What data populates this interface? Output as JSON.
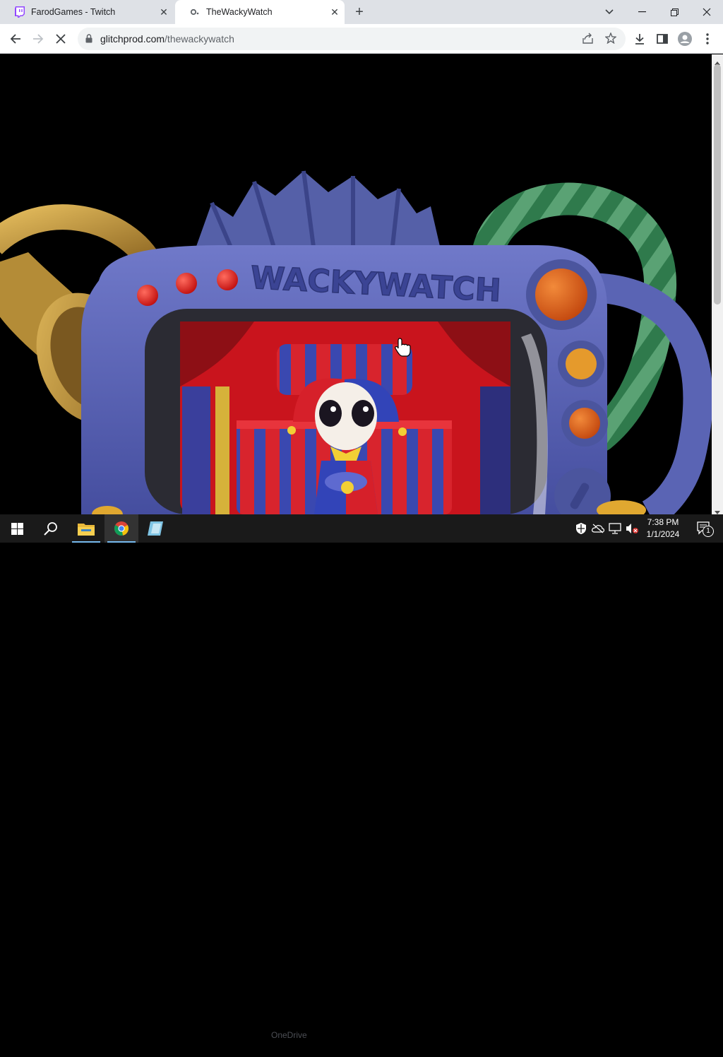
{
  "browser": {
    "tabs": [
      {
        "title": "FarodGames - Twitch",
        "active": false,
        "icon": "twitch-icon"
      },
      {
        "title": "TheWackyWatch",
        "active": true,
        "icon": "loading-favicon-icon"
      }
    ],
    "address": {
      "host": "glitchprod.com",
      "path": "/thewackywatch"
    }
  },
  "page": {
    "logo_text": "WACKYWATCH",
    "colors": {
      "frame": "#5b64b8",
      "frame_dark": "#3d4591",
      "button_red": "#e01b1b",
      "button_orange": "#e0621c",
      "horn_gold": "#c89a3a",
      "hose_green": "#3f8a5a"
    }
  },
  "taskbar": {
    "time": "7:38 PM",
    "date": "1/1/2024",
    "notification_count": "1",
    "ghost_label": "OneDrive"
  }
}
